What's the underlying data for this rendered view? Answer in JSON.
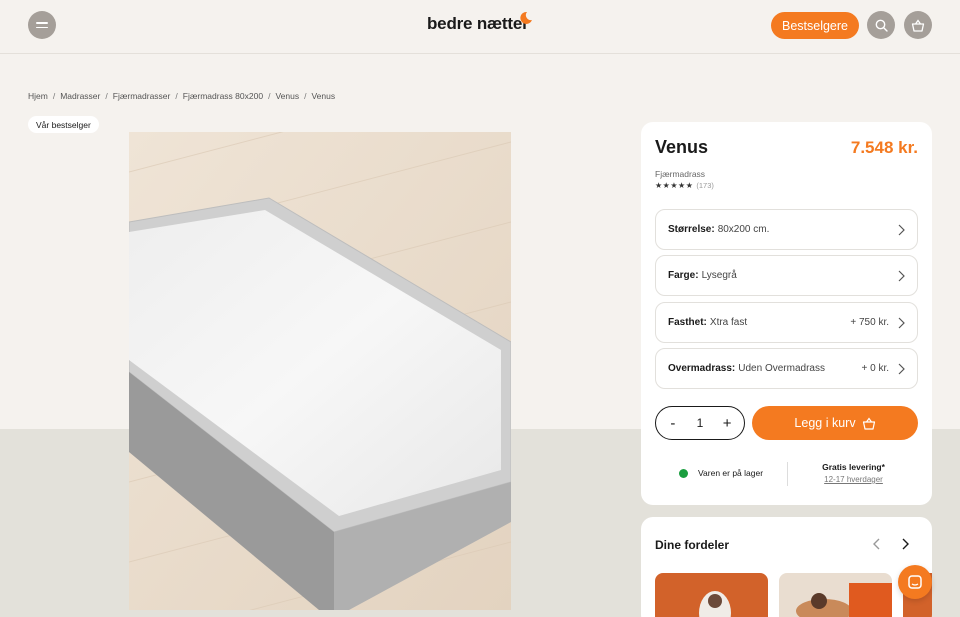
{
  "header": {
    "logo_text": "bedre nætter",
    "bestsellers_label": "Bestselgere",
    "brand_color": "#f47a20",
    "icons": [
      "menu-icon",
      "search-icon",
      "basket-icon"
    ]
  },
  "breadcrumb": [
    "Hjem",
    "Madrasser",
    "Fjærmadrasser",
    "Fjærmadrass 80x200",
    "Venus",
    "Venus"
  ],
  "badge": "Vår bestselger",
  "product": {
    "title": "Venus",
    "price": "7.548 kr.",
    "subtitle": "Fjærmadrass",
    "rating_stars": "★★★★★",
    "rating_count": "(173)",
    "options": [
      {
        "label": "Størrelse:",
        "value": "80x200 cm.",
        "extra": ""
      },
      {
        "label": "Farge:",
        "value": "Lysegrå",
        "extra": ""
      },
      {
        "label": "Fasthet:",
        "value": "Xtra fast",
        "extra": "+ 750 kr."
      },
      {
        "label": "Overmadrass:",
        "value": "Uden Overmadrass",
        "extra": "+ 0 kr."
      }
    ],
    "quantity": {
      "minus": "-",
      "value": "1",
      "plus": "+"
    },
    "add_to_cart": "Legg i kurv",
    "stock_text": "Varen er på lager",
    "stock_color": "#1a9e3f",
    "delivery_title": "Gratis levering*",
    "delivery_sub": "12-17 hverdager"
  },
  "benefits": {
    "title": "Dine fordeler"
  }
}
